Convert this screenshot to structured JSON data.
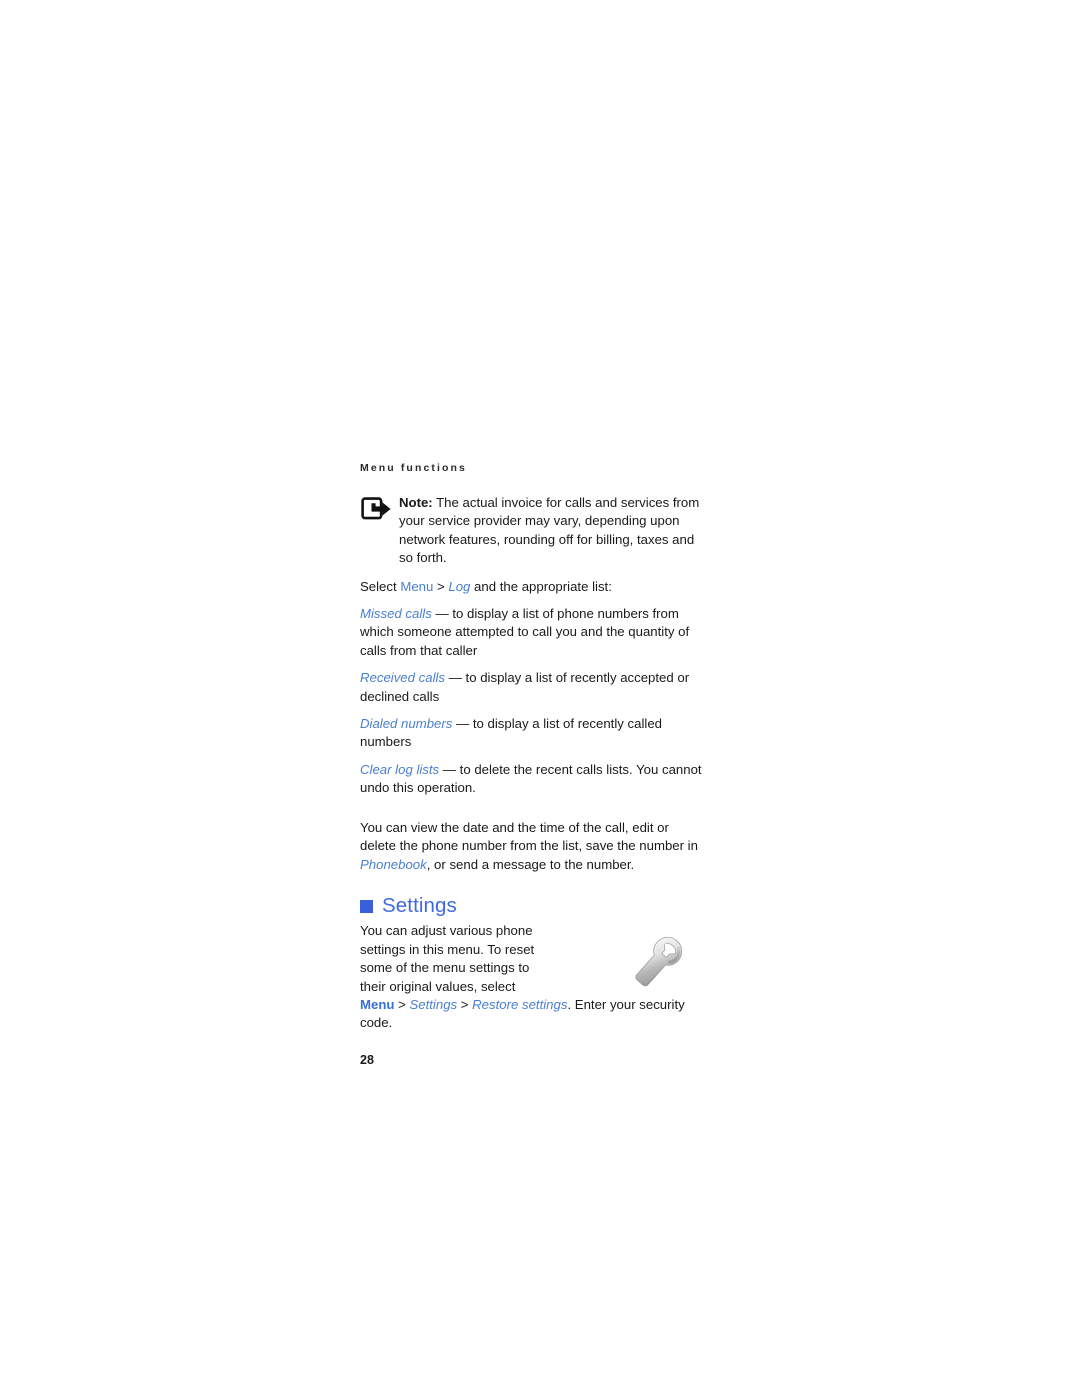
{
  "page": {
    "running_head": "Menu functions",
    "folio": "28"
  },
  "note": {
    "icon": "note-arrow-icon",
    "label": "Note:",
    "text": " The actual invoice for calls and services from your service provider may vary, depending upon network features, rounding off for billing, taxes and so forth."
  },
  "log_section": {
    "intro_prefix": "Select ",
    "intro_menu": "Menu",
    "intro_sep": " > ",
    "intro_log": "Log",
    "intro_suffix": " and the appropriate list:",
    "items": [
      {
        "term": "Missed calls",
        "definition": " — to display a list of phone numbers from which someone attempted to call you and the quantity of calls from that caller"
      },
      {
        "term": "Received calls",
        "definition": " — to display a list of recently accepted or declined calls"
      },
      {
        "term": "Dialed numbers",
        "definition": " — to display a list of recently called numbers"
      },
      {
        "term": "Clear log lists",
        "definition": " — to delete the recent calls lists. You cannot undo this operation."
      }
    ],
    "closing_prefix": "You can view the date and the time of the call, edit or delete the phone number from the list, save the number in ",
    "closing_link": "Phonebook",
    "closing_suffix": ", or send a message to the number."
  },
  "settings_section": {
    "bullet": "square-bullet",
    "title": "Settings",
    "illustration": "wrench-icon",
    "paragraph": "You can adjust various phone settings in this menu. To reset some of the menu settings to their original values, select",
    "path_menu": "Menu",
    "path_sep1": " > ",
    "path_settings": "Settings",
    "path_sep2": " > ",
    "path_restore": "Restore settings",
    "path_suffix": ". Enter your security code."
  },
  "colors": {
    "link_blue": "#4a7fd0",
    "heading_blue": "#4169e1",
    "bullet_blue": "#3a5fdb",
    "body_text": "#1a1a1a",
    "background": "#ffffff"
  }
}
